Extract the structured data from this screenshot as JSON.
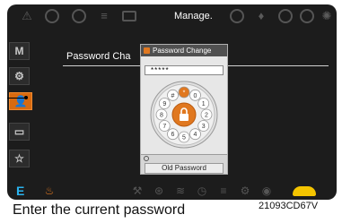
{
  "header": {
    "menu_title": "Manage."
  },
  "top_icons": [
    "warning-icon",
    "engine-oil-icon",
    "brake-icon",
    "battery-icon",
    "charging-icon",
    "speed-icon",
    "coolant-icon",
    "filter-icon",
    "hydraulic-icon",
    "settings-icon"
  ],
  "sidebar": {
    "items": [
      {
        "label": "M",
        "icon": "mode-icon"
      },
      {
        "label": "⚙",
        "icon": "gear-icon"
      },
      {
        "label": "👤",
        "icon": "person-icon"
      },
      {
        "label": "▭",
        "icon": "monitor-icon"
      },
      {
        "label": "☆",
        "icon": "star-icon"
      }
    ]
  },
  "content": {
    "field_label": "Password Cha"
  },
  "dialog": {
    "title": "Password Change",
    "password_value": "*****",
    "dial_digits": [
      "0",
      "1",
      "2",
      "3",
      "4",
      "5",
      "6",
      "7",
      "8",
      "9"
    ],
    "dial_symbols": [
      "#",
      "*"
    ],
    "footer_button": "Old Password"
  },
  "bottom_bar": {
    "mode_letter": "E"
  },
  "caption": "Enter the current password",
  "figure_id": "21093CD67V",
  "colors": {
    "accent": "#e07820",
    "highlight_blue": "#2ab4f0",
    "turtle": "#f4c400"
  }
}
